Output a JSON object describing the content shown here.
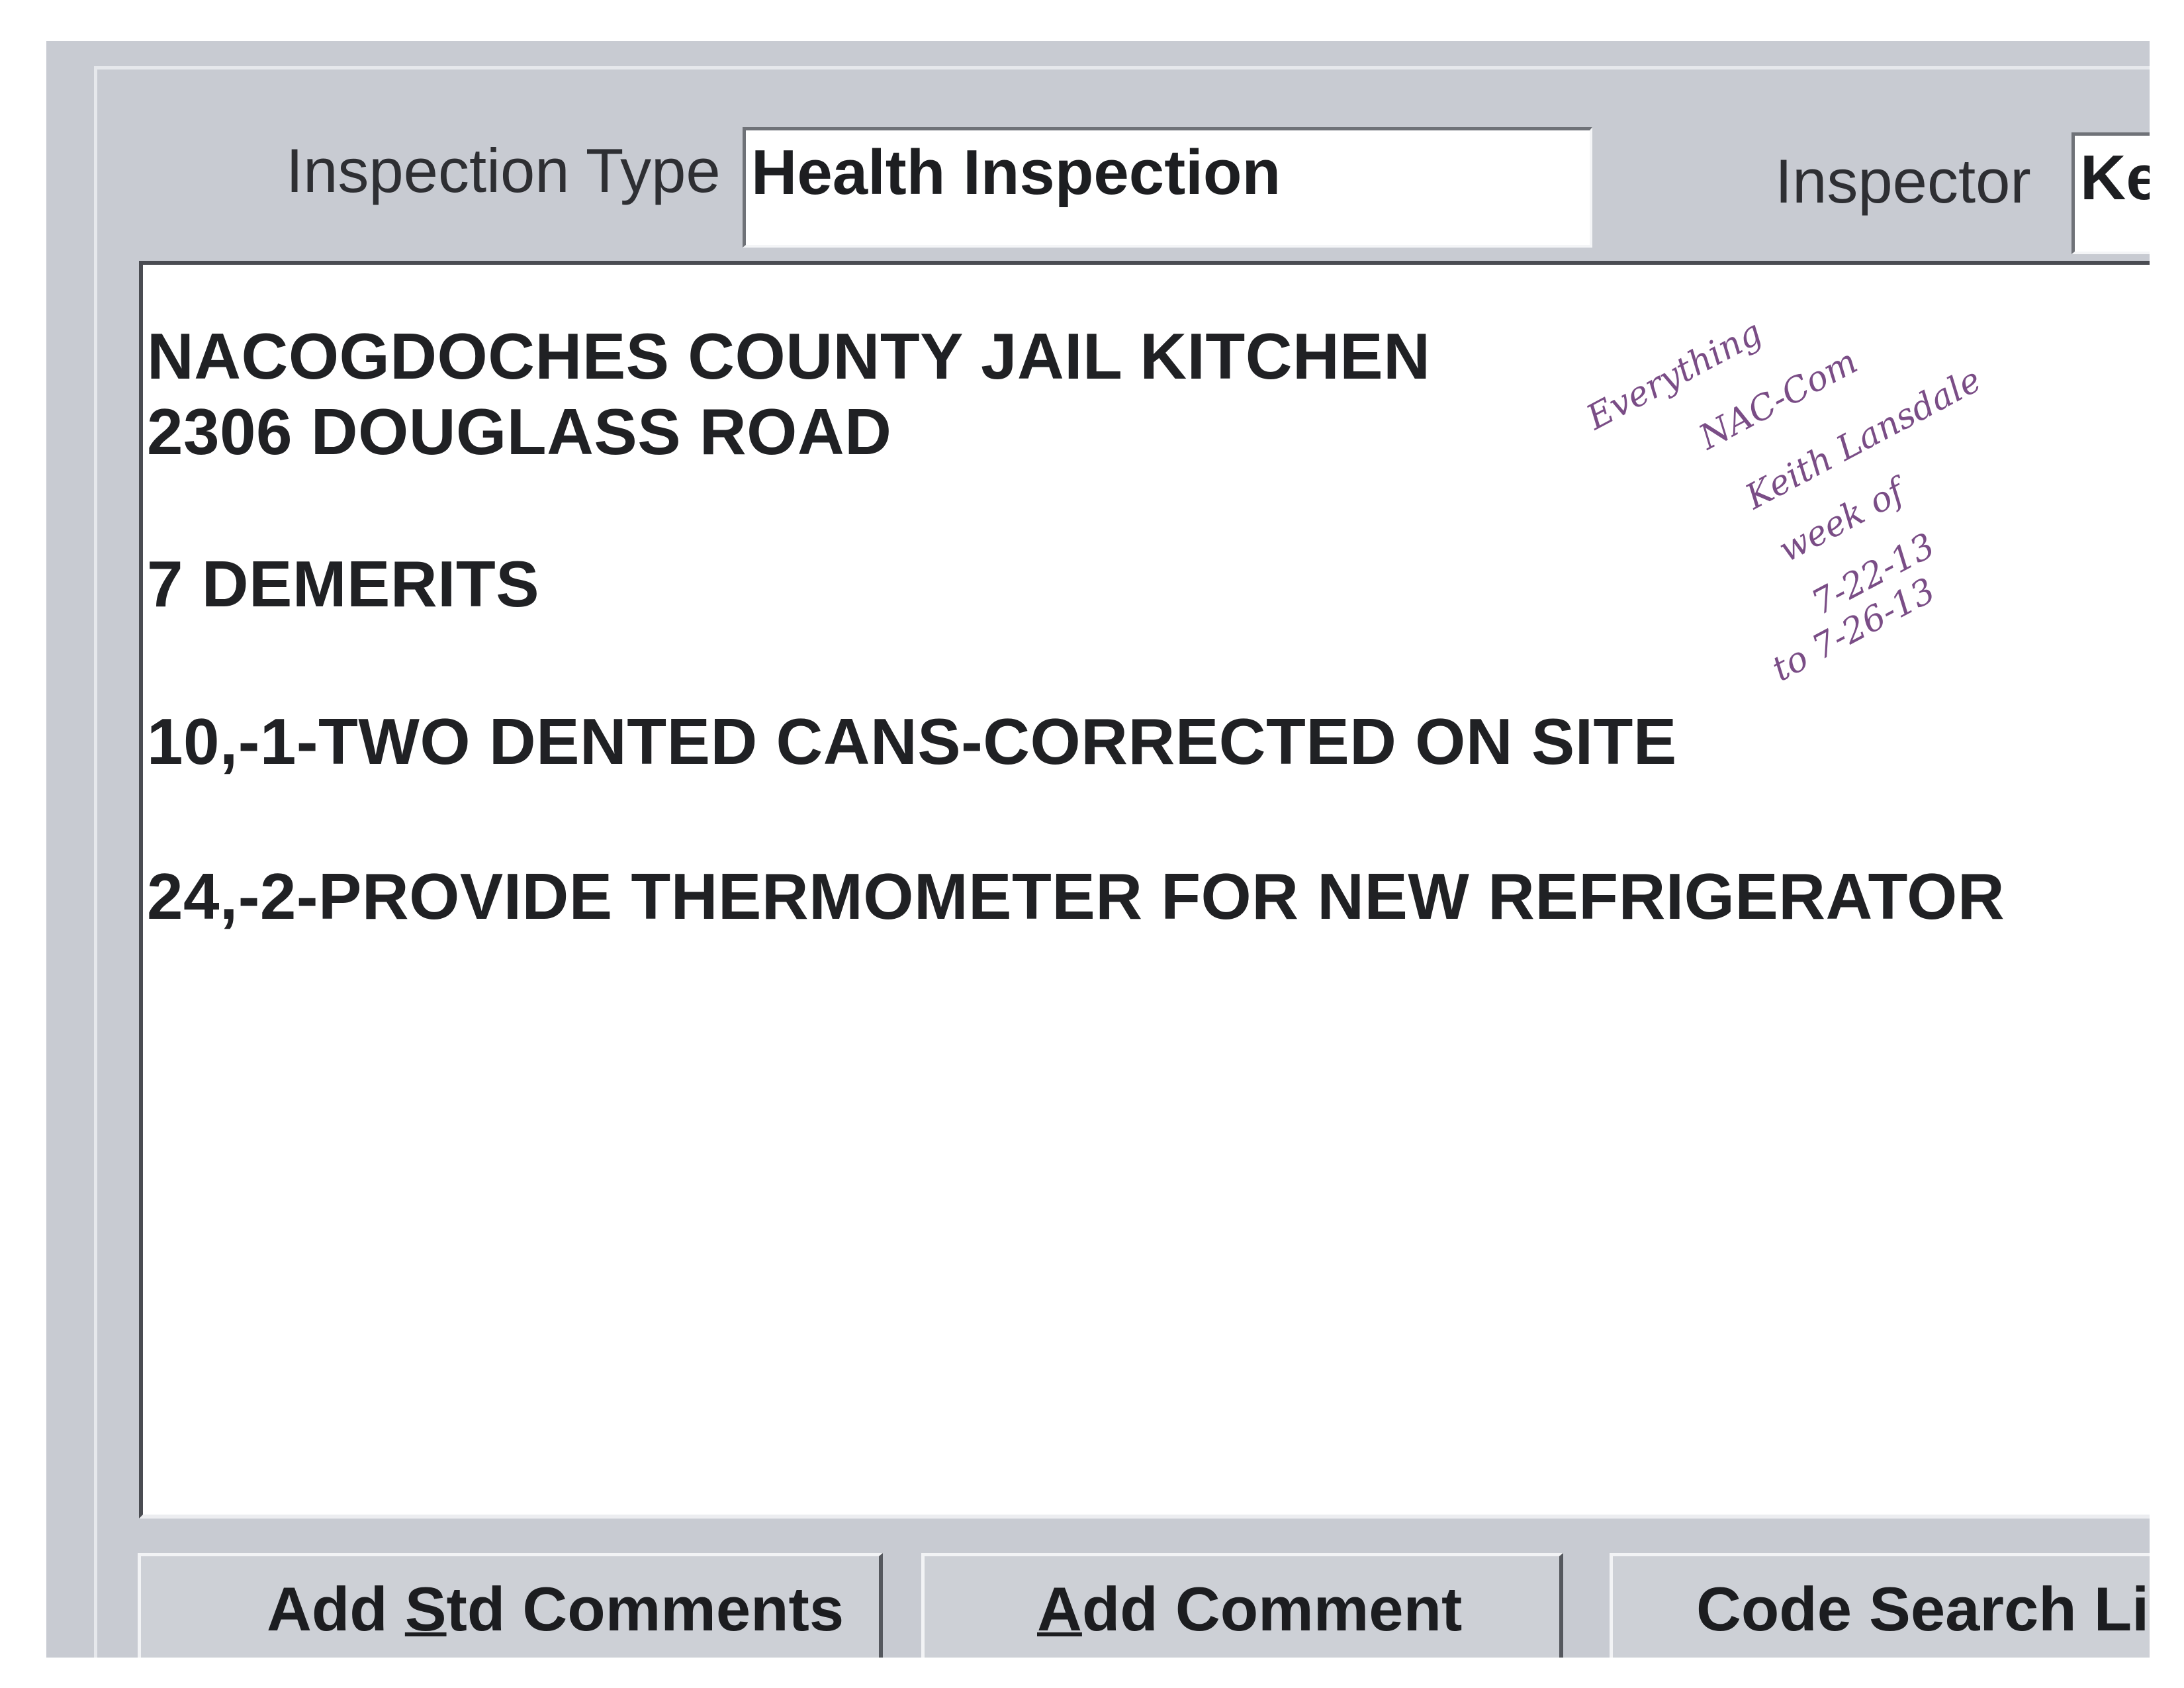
{
  "form": {
    "inspection_type_label": "Inspection Type",
    "inspection_type_value": "Health Inspection",
    "inspector_label": "Inspector",
    "inspector_value": "Ke"
  },
  "comments": {
    "lines": [
      "NACOGDOCHES COUNTY JAIL KITCHEN",
      "2306 DOUGLASS ROAD",
      "7 DEMERITS",
      "10,-1-TWO DENTED CANS-CORRECTED ON SITE",
      "24,-2-PROVIDE THERMOMETER FOR NEW REFRIGERATOR"
    ]
  },
  "handwritten_note": {
    "lines": [
      "Everything",
      "NAC-Com",
      "Keith Lansdale",
      "week of",
      "7-22-13",
      "to 7-26-13"
    ],
    "color": "#7a4d86"
  },
  "buttons": {
    "add_std_comments": {
      "pre": "Add ",
      "underlined": "S",
      "post": "td Comments"
    },
    "add_comment": {
      "pre": "",
      "underlined": "A",
      "post": "dd Comment"
    },
    "code_search": {
      "label": "Code Search Li"
    }
  }
}
